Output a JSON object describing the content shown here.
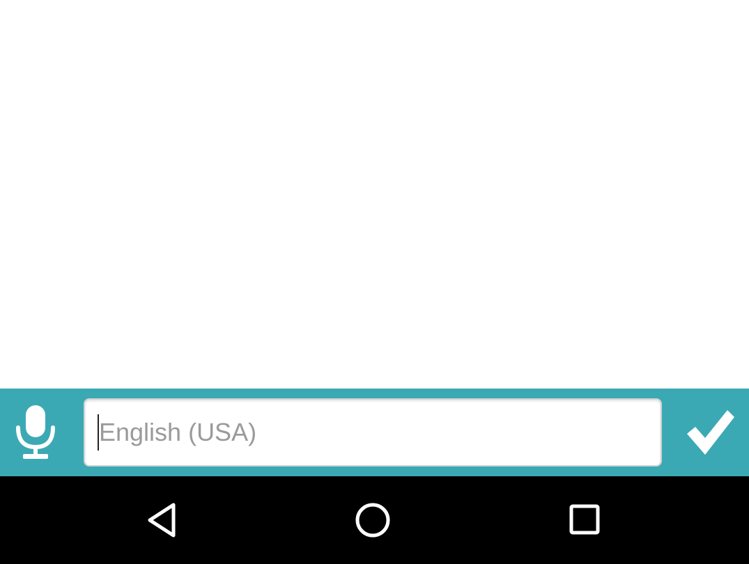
{
  "input_bar": {
    "background_color": "#3ba9b4",
    "mic_icon": "microphone-icon",
    "text_field": {
      "value": "",
      "placeholder": "English (USA)"
    },
    "confirm_icon": "checkmark-icon"
  },
  "nav_bar": {
    "background_color": "#000000",
    "icons": [
      "back-triangle-icon",
      "home-circle-icon",
      "recents-square-icon"
    ]
  }
}
